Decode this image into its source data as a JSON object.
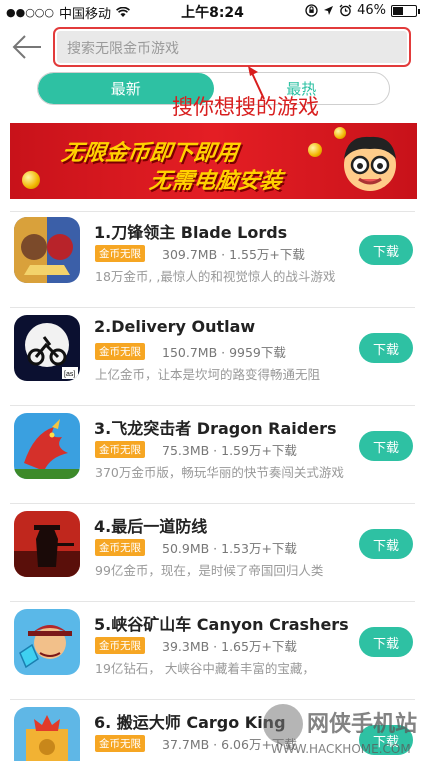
{
  "status_bar": {
    "signal": "●●○○○",
    "carrier": "中国移动",
    "time": "上午8:24",
    "battery_text": "46%",
    "battery_level": 0.46
  },
  "search": {
    "placeholder": "搜索无限金币游戏"
  },
  "tabs": [
    {
      "label": "最新"
    },
    {
      "label": "最热"
    }
  ],
  "annotation": "搜你想搜的游戏",
  "banner": {
    "line1": "无限金币即下即用",
    "line2": "无需电脑安装"
  },
  "apps": [
    {
      "title": "1.刀锋领主  Blade Lords",
      "badge": "金币无限",
      "meta": "309.7MB · 1.55万+下载",
      "desc": "18万金币, ,最惊人的和视觉惊人的战斗游戏",
      "button": "下载"
    },
    {
      "title": "2.Delivery Outlaw",
      "badge": "金币无限",
      "meta": "150.7MB · 9959下载",
      "desc": "上亿金币，让本是坎坷的路变得畅通无阻",
      "button": "下载"
    },
    {
      "title": "3.飞龙突击者 Dragon Raiders",
      "badge": "金币无限",
      "meta": "75.3MB · 1.59万+下载",
      "desc": "370万金币版，畅玩华丽的快节奏闯关式游戏",
      "button": "下载"
    },
    {
      "title": "4.最后一道防线",
      "badge": "金币无限",
      "meta": "50.9MB · 1.53万+下载",
      "desc": "99亿金币，现在，是时候了帝国回归人类",
      "button": "下载"
    },
    {
      "title": "5.峡谷矿山车 Canyon Crashers",
      "badge": "金币无限",
      "meta": "39.3MB · 1.65万+下载",
      "desc": "19亿钻石， 大峡谷中藏着丰富的宝藏，",
      "button": "下载"
    },
    {
      "title": "6. 搬运大师 Cargo King",
      "badge": "金币无限",
      "meta": "37.7MB · 6.06万+下载",
      "desc": "",
      "button": "下载"
    }
  ],
  "watermark": {
    "title": "网侠手机站",
    "url": "WWW.HACKHOME.COM"
  },
  "colors": {
    "accent": "#2ec1a3",
    "badge": "#f6a623",
    "annotation": "#d81e1e",
    "banner": "#e41e24"
  }
}
